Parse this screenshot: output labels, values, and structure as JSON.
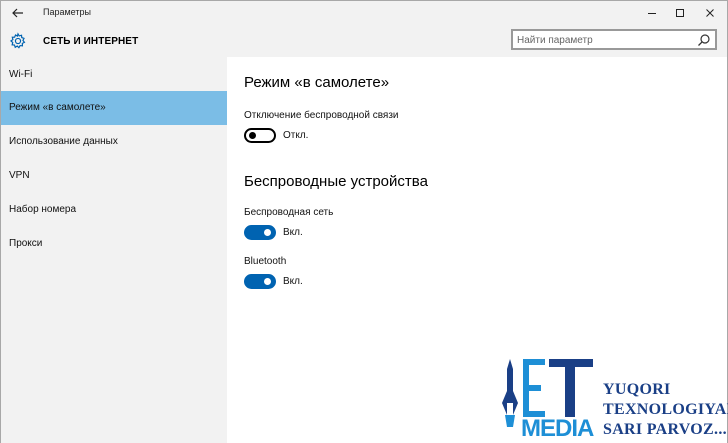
{
  "window": {
    "title": "Параметры"
  },
  "header": {
    "title": "СЕТЬ И ИНТЕРНЕТ",
    "search_placeholder": "Найти параметр"
  },
  "sidebar": {
    "items": [
      {
        "label": "Wi-Fi",
        "active": false
      },
      {
        "label": "Режим «в самолете»",
        "active": true
      },
      {
        "label": "Использование данных",
        "active": false
      },
      {
        "label": "VPN",
        "active": false
      },
      {
        "label": "Набор номера",
        "active": false
      },
      {
        "label": "Прокси",
        "active": false
      }
    ]
  },
  "main": {
    "airplane_title": "Режим «в самолете»",
    "airplane_setting": {
      "label": "Отключение беспроводной связи",
      "state": "Откл."
    },
    "wireless_title": "Беспроводные устройства",
    "wifi_setting": {
      "label": "Беспроводная сеть",
      "state": "Вкл."
    },
    "bluetooth_setting": {
      "label": "Bluetooth",
      "state": "Вкл."
    }
  },
  "watermark": {
    "logo_letters": "ET",
    "logo_word": "MEDIA",
    "tagline_1": "YUQORI",
    "tagline_2": "TEXNOLOGIYALAR",
    "tagline_3": "SARI PARVOZ..."
  },
  "colors": {
    "accent": "#0063b1",
    "selected_nav": "#7bbde6",
    "panel_bg": "#f2f2f2",
    "logo_blue": "#1a3f86",
    "logo_light": "#1e8fd6"
  },
  "icons": {
    "back": "back-arrow-icon",
    "settings": "gear-icon",
    "search": "search-icon",
    "minimize": "minimize-icon",
    "maximize": "maximize-icon",
    "close": "close-icon"
  }
}
